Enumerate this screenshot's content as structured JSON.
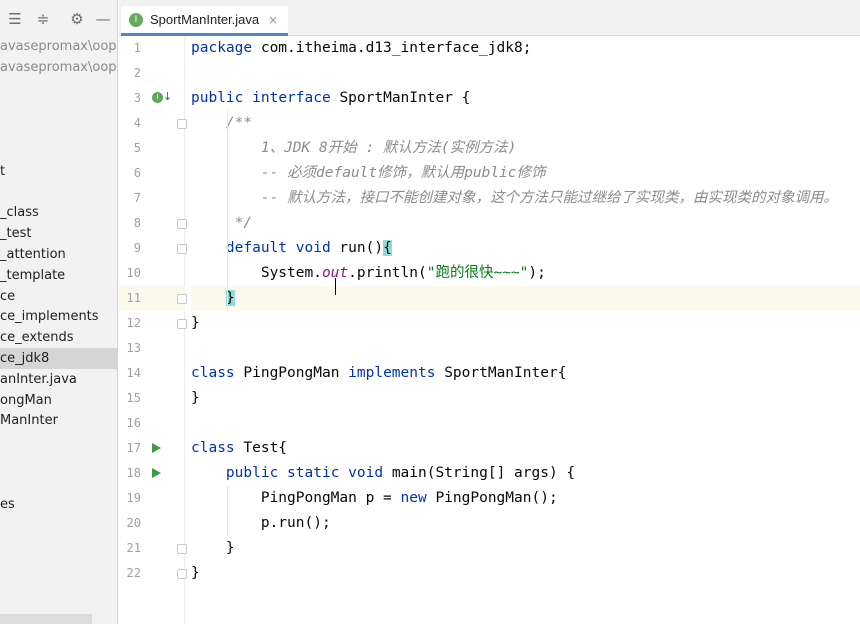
{
  "tab": {
    "label": "SportManInter.java",
    "icon_letter": "I",
    "close": "×"
  },
  "toolbar": {
    "icons": [
      "collapse-all-icon",
      "expand-all-icon",
      "gear-icon",
      "minimize-icon"
    ],
    "glyphs": {
      "collapse": "☰",
      "expand": "≑",
      "gear": "⚙",
      "minimize": "—"
    }
  },
  "sidebar": {
    "items": [
      {
        "label": "avasepromax\\oop-a",
        "kind": "path"
      },
      {
        "label": "avasepromax\\oop-a",
        "kind": "path"
      },
      {
        "label": "",
        "kind": "blank"
      },
      {
        "label": "",
        "kind": "blank"
      },
      {
        "label": "",
        "kind": "blank"
      },
      {
        "label": "",
        "kind": "blank"
      },
      {
        "label": "t",
        "kind": "item"
      },
      {
        "label": "",
        "kind": "blank"
      },
      {
        "label": "_class",
        "kind": "item"
      },
      {
        "label": "_test",
        "kind": "item"
      },
      {
        "label": "_attention",
        "kind": "item"
      },
      {
        "label": "_template",
        "kind": "item"
      },
      {
        "label": "ce",
        "kind": "item"
      },
      {
        "label": "ce_implements",
        "kind": "item"
      },
      {
        "label": "ce_extends",
        "kind": "item"
      },
      {
        "label": "ce_jdk8",
        "kind": "selected"
      },
      {
        "label": "anInter.java",
        "kind": "item"
      },
      {
        "label": "ongMan",
        "kind": "item"
      },
      {
        "label": "ManInter",
        "kind": "item"
      },
      {
        "label": "",
        "kind": "blank"
      },
      {
        "label": "",
        "kind": "blank"
      },
      {
        "label": "",
        "kind": "blank"
      },
      {
        "label": "es",
        "kind": "item"
      }
    ]
  },
  "editor": {
    "current_line": 11,
    "lines": [
      {
        "n": "1",
        "tokens": [
          [
            "kw",
            "package"
          ],
          [
            "",
            "com.itheima.d13_interface_jdk8;"
          ]
        ]
      },
      {
        "n": "2",
        "tokens": []
      },
      {
        "n": "3",
        "tokens": [
          [
            "kw",
            "public"
          ],
          [
            "",
            ""
          ],
          [
            "kw",
            "interface"
          ],
          [
            "",
            "SportManInter {"
          ]
        ]
      },
      {
        "n": "4",
        "tokens": [
          [
            "",
            "    "
          ],
          [
            "cm",
            "/**"
          ]
        ]
      },
      {
        "n": "5",
        "tokens": [
          [
            "",
            "        "
          ],
          [
            "cm",
            "1、JDK 8开始 : 默认方法(实例方法)"
          ]
        ]
      },
      {
        "n": "6",
        "tokens": [
          [
            "",
            "        "
          ],
          [
            "cm",
            "-- 必须default修饰，默认用public修饰"
          ]
        ]
      },
      {
        "n": "7",
        "tokens": [
          [
            "",
            "        "
          ],
          [
            "cm",
            "-- 默认方法，接口不能创建对象，这个方法只能过继给了实现类，由实现类的对象调用。"
          ]
        ]
      },
      {
        "n": "8",
        "tokens": [
          [
            "",
            "     "
          ],
          [
            "cm",
            "*/"
          ]
        ]
      },
      {
        "n": "9",
        "tokens": [
          [
            "",
            "    "
          ],
          [
            "kw",
            "default"
          ],
          [
            "",
            ""
          ],
          [
            "kw",
            "void"
          ],
          [
            "",
            "run()"
          ],
          [
            "hl",
            "{"
          ]
        ]
      },
      {
        "n": "10",
        "tokens": [
          [
            "",
            "        System."
          ],
          [
            "sf",
            "out"
          ],
          [
            "",
            ".println("
          ],
          [
            "str",
            "\"跑的很快~~~\""
          ],
          [
            "",
            ");"
          ]
        ]
      },
      {
        "n": "11",
        "tokens": [
          [
            "",
            "    "
          ],
          [
            "hl",
            "}"
          ]
        ]
      },
      {
        "n": "12",
        "tokens": [
          [
            "",
            "}"
          ]
        ]
      },
      {
        "n": "13",
        "tokens": []
      },
      {
        "n": "14",
        "tokens": [
          [
            "kw",
            "class"
          ],
          [
            "",
            "PingPongMan "
          ],
          [
            "kw",
            "implements"
          ],
          [
            "",
            "SportManInter{"
          ]
        ]
      },
      {
        "n": "15",
        "tokens": [
          [
            "",
            "}"
          ]
        ]
      },
      {
        "n": "16",
        "tokens": []
      },
      {
        "n": "17",
        "tokens": [
          [
            "kw",
            "class"
          ],
          [
            "",
            "Test{"
          ]
        ]
      },
      {
        "n": "18",
        "tokens": [
          [
            "",
            "    "
          ],
          [
            "kw",
            "public"
          ],
          [
            "",
            ""
          ],
          [
            "kw",
            "static"
          ],
          [
            "",
            ""
          ],
          [
            "kw",
            "void"
          ],
          [
            "",
            "main(String[] args) {"
          ]
        ]
      },
      {
        "n": "19",
        "tokens": [
          [
            "",
            "        PingPongMan p = "
          ],
          [
            "kw",
            "new"
          ],
          [
            "",
            "PingPongMan();"
          ]
        ]
      },
      {
        "n": "20",
        "tokens": [
          [
            "",
            "        p.run();"
          ]
        ]
      },
      {
        "n": "21",
        "tokens": [
          [
            "",
            "    }"
          ]
        ]
      },
      {
        "n": "22",
        "tokens": [
          [
            "",
            "}"
          ]
        ]
      }
    ],
    "run_lines": [
      17,
      18
    ],
    "impl_lines": [
      3
    ],
    "fold_lines": [
      4,
      8,
      9,
      11,
      12,
      21,
      22
    ]
  },
  "colors": {
    "keyword": "#0033b3",
    "comment": "#8c8c8c",
    "string": "#067d17",
    "static_field": "#871094",
    "brace_highlight": "#93d9d9",
    "current_line": "#fcfaed",
    "tab_underline": "#4a88c7"
  }
}
